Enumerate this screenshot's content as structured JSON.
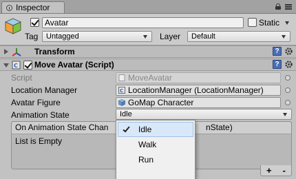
{
  "window": {
    "tab_title": "Inspector"
  },
  "header": {
    "object_name": "Avatar",
    "static_label": "Static",
    "tag_label": "Tag",
    "tag_value": "Untagged",
    "layer_label": "Layer",
    "layer_value": "Default"
  },
  "components": {
    "transform": {
      "title": "Transform"
    },
    "move_avatar": {
      "title": "Move Avatar (Script)",
      "fields": {
        "script": {
          "label": "Script",
          "value": "MoveAvatar"
        },
        "location_manager": {
          "label": "Location Manager",
          "value": "LocationManager (LocationManager)"
        },
        "avatar_figure": {
          "label": "Avatar Figure",
          "value": "GoMap Character"
        },
        "animation_state": {
          "label": "Animation State",
          "value": "Idle"
        }
      },
      "event": {
        "header_left": "On Animation State Chan",
        "header_right": "nState)",
        "empty_text": "List is Empty",
        "add_label": "+",
        "remove_label": "-"
      }
    }
  },
  "dropdown": {
    "options": [
      "Idle",
      "Walk",
      "Run"
    ],
    "selected": "Idle"
  },
  "colors": {
    "panel_bg": "#c2c2c2",
    "selection_bg": "#d9e8f8",
    "help_icon": "#4a6fb5"
  }
}
